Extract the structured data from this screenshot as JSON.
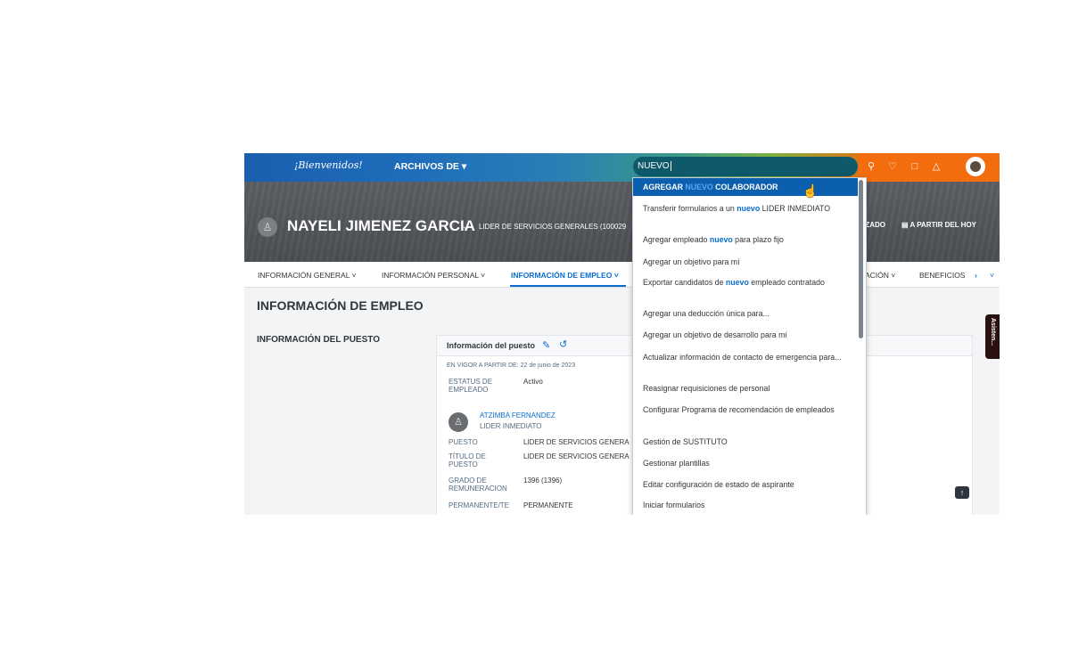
{
  "shellbar": {
    "logo": "¡Bienvenidos!",
    "archivos_label": "ARCHIVOS DE ▾",
    "search_value": "NUEVO",
    "icons": [
      "search-icon",
      "feedback-icon",
      "reading-icon",
      "notifications-icon",
      "user-avatar"
    ]
  },
  "header": {
    "employee_name": "NAYELI JIMENEZ GARCIA",
    "employee_title": "LIDER DE SERVICIOS GENERALES (100029",
    "right_label_1": "EZADO",
    "right_label_2": "A PARTIR DEL HOY"
  },
  "tabs": [
    {
      "label": "INFORMACIÓN GENERAL ˅"
    },
    {
      "label": "INFORMACIÓN PERSONAL ˅"
    },
    {
      "label": "INFORMACIÓN DE EMPLEO ˅"
    },
    {
      "label": "ACIÓN ˅"
    },
    {
      "label": "BENEFICIOS"
    },
    {
      "label": "›"
    },
    {
      "label": "˅"
    }
  ],
  "main": {
    "section_title": "INFORMACIÓN DE EMPLEO",
    "subsection_title": "INFORMACIÓN DEL PUESTO",
    "card": {
      "title": "Información del puesto",
      "effective": "EN VIGOR A PARTIR DE: 22 de junio de 2023",
      "status_label": "ESTATUS DE EMPLEADO",
      "status_value": "Activo",
      "manager_name": "ATZIMBA FERNANDEZ",
      "manager_role": "LIDER INMEDIATO",
      "puesto_label": "PUESTO",
      "puesto_value": "LIDER DE SERVICIOS GENERA",
      "titulo_label": "TÍTULO DE PUESTO",
      "titulo_value": "LIDER DE SERVICIOS GENERA",
      "grado_label": "GRADO DE REMUNERACION",
      "grado_value": "1396 (1396)",
      "perm_label": "PERMANENTE/TE",
      "perm_value": "PERMANENTE"
    }
  },
  "dropdown": {
    "highlighted": {
      "pre": "AGREGAR ",
      "kw": "NUEVO",
      "post": " COLABORADOR"
    },
    "items": [
      {
        "pre": "Transferir formularios a un ",
        "kw": "nuevo",
        "post": " LIDER INMEDIATO"
      },
      {
        "pre": "Agregar empleado ",
        "kw": "nuevo",
        "post": " para plazo fijo"
      },
      {
        "pre": "Agregar un objetivo para mí",
        "kw": "",
        "post": ""
      },
      {
        "pre": "Exportar candidatos de ",
        "kw": "nuevo",
        "post": " empleado contratado"
      },
      {
        "pre": "Agregar una deducción única para...",
        "kw": "",
        "post": ""
      },
      {
        "pre": "Agregar un objetivo de desarrollo para mí",
        "kw": "",
        "post": ""
      },
      {
        "pre": "Actualizar información de contacto de emergencia para...",
        "kw": "",
        "post": ""
      },
      {
        "pre": "Reasignar requisiciones de personal",
        "kw": "",
        "post": ""
      },
      {
        "pre": "Configurar Programa de recomendación de empleados",
        "kw": "",
        "post": ""
      },
      {
        "pre": "Gestión de SUSTITUTO",
        "kw": "",
        "post": ""
      },
      {
        "pre": "Gestionar plantillas",
        "kw": "",
        "post": ""
      },
      {
        "pre": "Editar configuración de estado de aspirante",
        "kw": "",
        "post": ""
      },
      {
        "pre": "Iniciar formularios",
        "kw": "",
        "post": ""
      }
    ]
  },
  "side_tab_label": "Asisten...",
  "colors": {
    "accent": "#0a6ed1",
    "highlight": "#0b5fae",
    "orange": "#f36c0d"
  }
}
